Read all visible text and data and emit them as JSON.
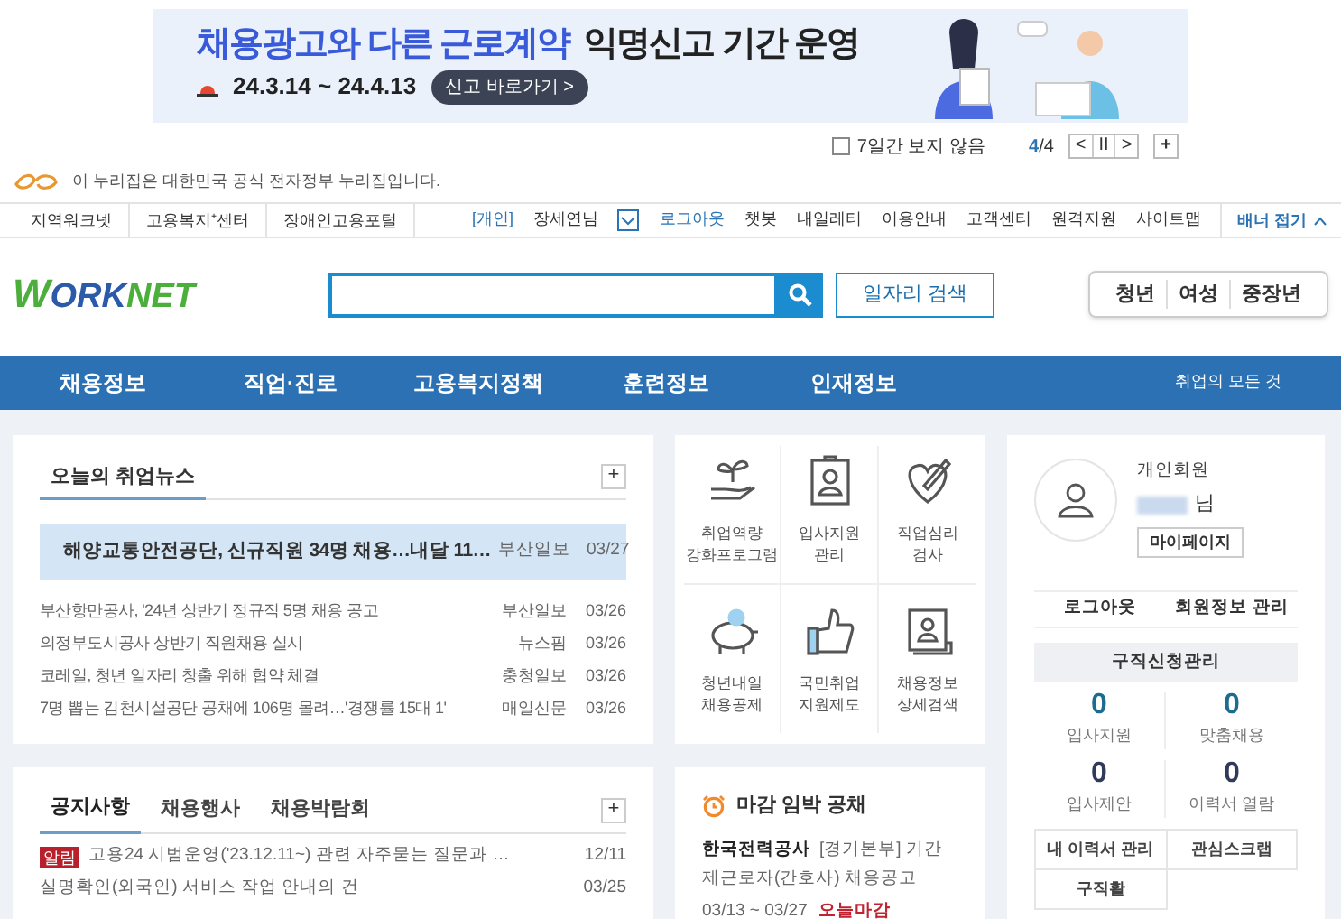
{
  "banner": {
    "title_highlight": "채용광고와 다른 근로계약",
    "title_rest": "익명신고 기간 운영",
    "period": "24.3.14 ~ 24.4.13",
    "cta": "신고 바로가기 >"
  },
  "banner_controls": {
    "hide_label": "7일간 보지 않음",
    "hide_checked": false,
    "page_current": "4",
    "page_total": "/4",
    "prev": "<",
    "pause": "II",
    "next": ">",
    "more": "+"
  },
  "gov_notice": "이 누리집은 대한민국 공식 전자정부 누리집입니다.",
  "utility_left": [
    "지역워크넷",
    "고용복지⁺센터",
    "장애인고용포털"
  ],
  "utility_user": {
    "type": "[개인]",
    "name": "장세연님"
  },
  "utility_right": [
    "로그아웃",
    "챗봇",
    "내일레터",
    "이용안내",
    "고객센터",
    "원격지원",
    "사이트맵"
  ],
  "banner_toggle": "배너 접기",
  "logo": {
    "first": "W",
    "rest_a": "ORK",
    "rest_b": "NET"
  },
  "search": {
    "button": "일자리 검색"
  },
  "segments": [
    "청년",
    "여성",
    "중장년"
  ],
  "nav": [
    "채용정보",
    "직업·진로",
    "고용복지정책",
    "훈련정보",
    "인재정보"
  ],
  "nav_right": "취업의 모든 것",
  "news": {
    "title": "오늘의 취업뉴스",
    "more": "+",
    "featured": {
      "title": "해양교통안전공단, 신규직원 34명 채용…내달 11…",
      "source": "부산일보",
      "date": "03/27"
    },
    "items": [
      {
        "title": "부산항만공사, '24년 상반기 정규직 5명 채용 공고",
        "source": "부산일보",
        "date": "03/26"
      },
      {
        "title": "의정부도시공사 상반기 직원채용 실시",
        "source": "뉴스핌",
        "date": "03/26"
      },
      {
        "title": "코레일, 청년 일자리 창출 위해 협약 체결",
        "source": "충청일보",
        "date": "03/26"
      },
      {
        "title": "7명 뽑는 김천시설공단 공채에 106명 몰려…'경쟁률 15대 1'",
        "source": "매일신문",
        "date": "03/26"
      }
    ]
  },
  "quick_menu": [
    {
      "kind": "sprout",
      "label": "취업역량\n강화프로그램"
    },
    {
      "kind": "idcard",
      "label": "입사지원\n관리"
    },
    {
      "kind": "heart",
      "label": "직업심리\n검사"
    },
    {
      "kind": "piggy",
      "label": "청년내일\n채용공제"
    },
    {
      "kind": "thumb",
      "label": "국민취업\n지원제도"
    },
    {
      "kind": "scroll",
      "label": "채용정보\n상세검색"
    }
  ],
  "member": {
    "type": "개인회원",
    "suffix": "님",
    "mypage": "마이페이지",
    "logout": "로그아웃",
    "info": "회원정보 관리",
    "section": "구직신청관리",
    "stats": [
      {
        "value": "0",
        "label": "입사지원"
      },
      {
        "value": "0",
        "label": "맞춤채용"
      },
      {
        "value": "0",
        "label": "입사제안"
      },
      {
        "value": "0",
        "label": "이력서 열람"
      }
    ],
    "links": [
      "내 이력서 관리",
      "관심스크랩",
      "구직활"
    ]
  },
  "notices": {
    "tabs": [
      {
        "label": "공지사항",
        "selected": true
      },
      {
        "label": "채용행사",
        "selected": false
      },
      {
        "label": "채용박람회",
        "selected": false
      }
    ],
    "more": "+",
    "items": [
      {
        "badge": "알림",
        "title": "고용24 시범운영('23.12.11~) 관련 자주묻는 질문과 …",
        "date": "12/11"
      },
      {
        "title": "실명확인(외국인) 서비스 작업 안내의 건",
        "date": "03/25"
      }
    ]
  },
  "deadline": {
    "title": "마감 임박 공채",
    "company": "한국전력공사",
    "desc": "[경기본부] 기간제근로자(간호사) 채용공고",
    "period": "03/13 ~ 03/27",
    "status": "오늘마감"
  }
}
